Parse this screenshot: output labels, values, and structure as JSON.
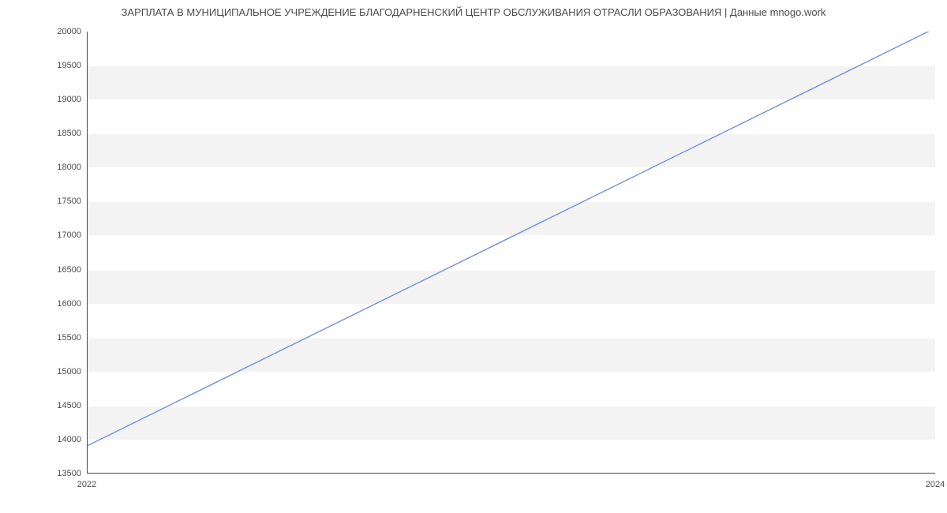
{
  "chart_data": {
    "type": "line",
    "title": "ЗАРПЛАТА В МУНИЦИПАЛЬНОЕ УЧРЕЖДЕНИЕ БЛАГОДАРНЕНСКИЙ ЦЕНТР ОБСЛУЖИВАНИЯ ОТРАСЛИ ОБРАЗОВАНИЯ | Данные mnogo.work",
    "x": [
      2022,
      2024
    ],
    "values": [
      13900,
      20050
    ],
    "xlabel": "",
    "ylabel": "",
    "xlim": [
      2022,
      2024
    ],
    "ylim": [
      13500,
      20000
    ],
    "x_ticks": [
      2022,
      2024
    ],
    "y_ticks": [
      13500,
      14000,
      14500,
      15000,
      15500,
      16000,
      16500,
      17000,
      17500,
      18000,
      18500,
      19000,
      19500,
      20000
    ],
    "line_color": "#6f8fd8",
    "band_color": "#f3f3f3"
  }
}
